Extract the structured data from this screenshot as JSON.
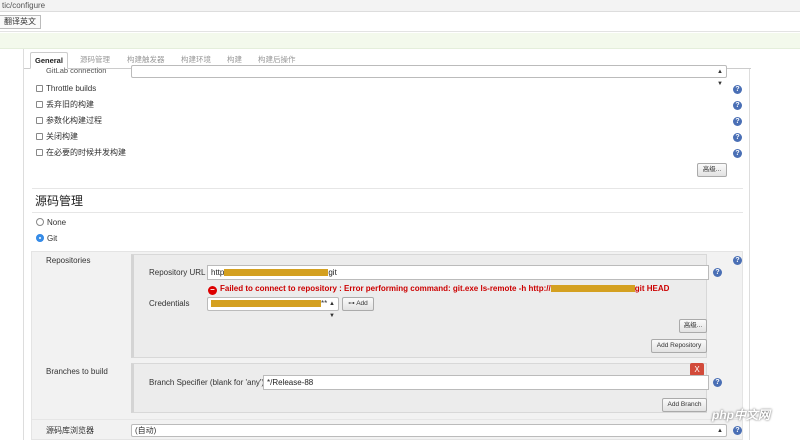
{
  "browser": {
    "url": "tic/configure",
    "bookmark_label": "翻译英文"
  },
  "tabs": [
    {
      "label": "General",
      "active": true
    },
    {
      "label": "源码管理"
    },
    {
      "label": "构建触发器"
    },
    {
      "label": "构建环境"
    },
    {
      "label": "构建"
    },
    {
      "label": "构建后操作"
    }
  ],
  "general": {
    "gitlab_label": "GitLab connection",
    "options": [
      {
        "label": "Throttle builds",
        "checked": false
      },
      {
        "label": "丢弃旧的构建",
        "checked": false
      },
      {
        "label": "参数化构建过程",
        "checked": false
      },
      {
        "label": "关闭构建",
        "checked": false
      },
      {
        "label": "在必要的时候并发构建",
        "checked": false
      }
    ],
    "advanced_button": "高级..."
  },
  "scm": {
    "title": "源码管理",
    "none_label": "None",
    "git_label": "Git",
    "selected": "Git",
    "repositories_label": "Repositories",
    "repo_url_label": "Repository URL",
    "repo_url_prefix": "http",
    "repo_url_suffix": "git",
    "error_message_start": "Failed to connect to repository : Error performing command: git.exe ls-remote -h http://",
    "error_message_end": "git HEAD",
    "credentials_label": "Credentials",
    "credentials_suffix": "**",
    "add_button": "Add",
    "advanced_button": "高级...",
    "add_repository_button": "Add Repository",
    "branches_label": "Branches to build",
    "branch_specifier_label": "Branch Specifier (blank for 'any')",
    "branch_specifier_value": "*/Release-88",
    "delete_button": "X",
    "add_branch_button": "Add Branch",
    "browser_label": "源码库浏览器",
    "browser_value": "(自动)"
  },
  "watermark": "php中文网",
  "colors": {
    "error": "#cc0000",
    "help": "#4a6fb5",
    "radio_selected": "#3a8ee6",
    "delete": "#d24a3a",
    "redaction": "#d4a020"
  }
}
